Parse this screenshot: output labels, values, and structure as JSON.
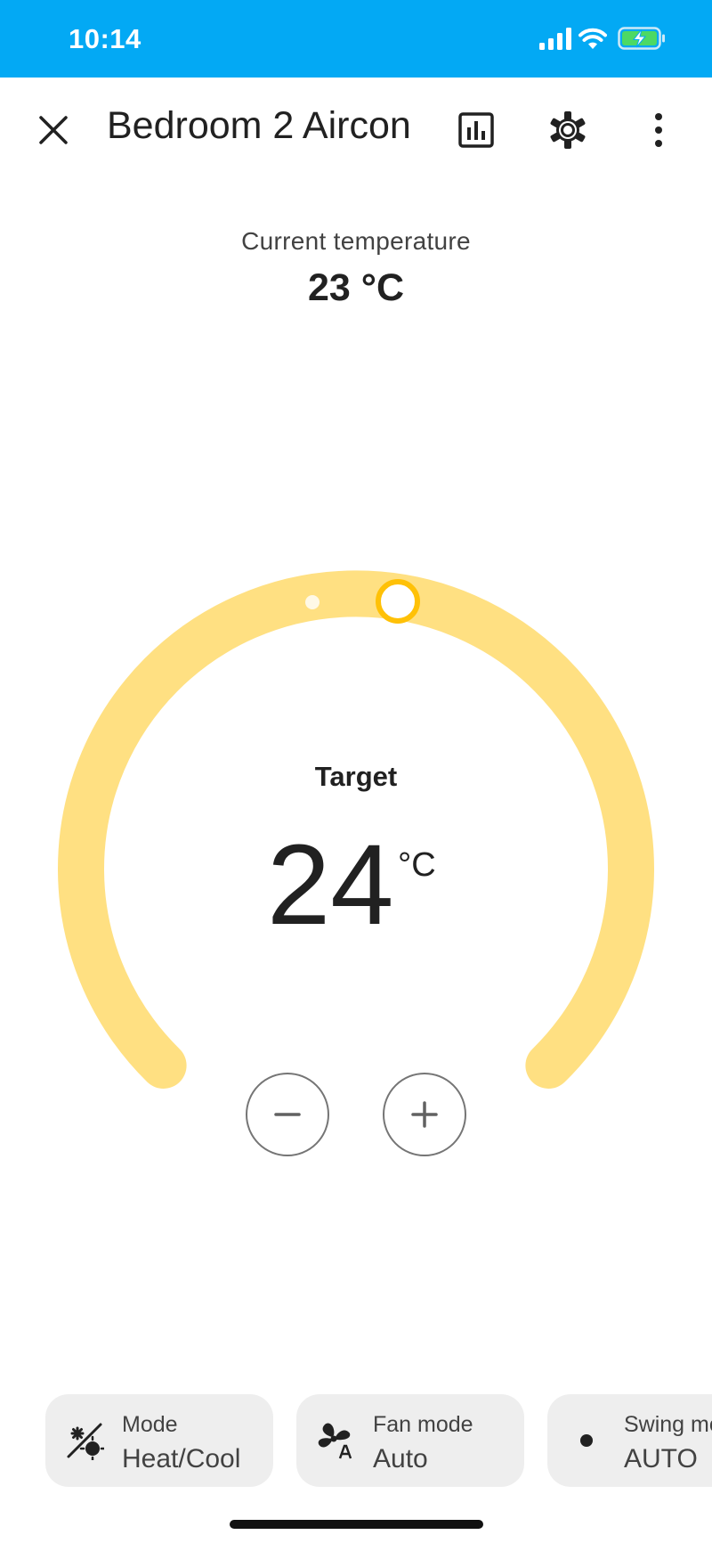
{
  "status_bar": {
    "time": "10:14",
    "signal_icon": "cellular-signal-icon",
    "wifi_icon": "wifi-icon",
    "battery_icon": "battery-charging-icon",
    "background": "#03a9f4"
  },
  "toolbar": {
    "close_icon": "close-icon",
    "title": "Bedroom 2 Aircon",
    "history_icon": "bar-chart-icon",
    "settings_icon": "gear-icon",
    "more_icon": "more-vertical-icon"
  },
  "current": {
    "label": "Current temperature",
    "value": "23 °C"
  },
  "thermostat": {
    "target_label": "Target",
    "target_value": "24",
    "unit": "°C",
    "arc_color": "#ffe082",
    "handle_color": "#ffc107",
    "decrease_icon": "minus-icon",
    "increase_icon": "plus-icon"
  },
  "controls": [
    {
      "title": "Mode",
      "value": "Heat/Cool",
      "icon": "sun-snowflake-icon"
    },
    {
      "title": "Fan mode",
      "value": "Auto",
      "icon": "fan-auto-icon"
    },
    {
      "title": "Swing mode",
      "value": "AUTO",
      "icon": "dot-icon"
    }
  ]
}
